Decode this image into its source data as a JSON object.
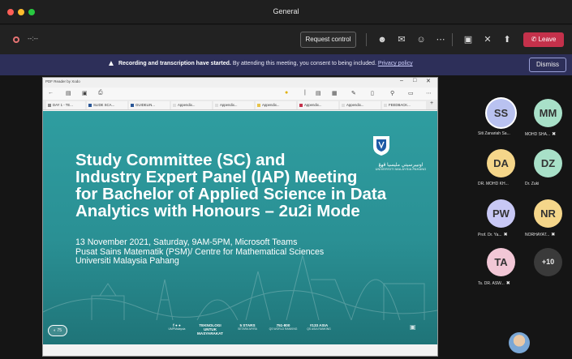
{
  "window": {
    "title": "General",
    "traffic_lights": [
      "#ff5f57",
      "#febc2e",
      "#28c840"
    ]
  },
  "toolbar": {
    "timer": "--:--",
    "request_control_label": "Request control",
    "icons": [
      "people-icon",
      "chat-icon",
      "reactions-icon",
      "more-icon",
      "camera-off-icon",
      "mic-off-icon",
      "share-icon"
    ],
    "leave_label": "Leave"
  },
  "banner": {
    "bold_text": "Recording and transcription have started.",
    "text": "By attending this meeting, you consent to being included.",
    "link": "Privacy policy",
    "dismiss_label": "Dismiss"
  },
  "pdf_viewer": {
    "title": "PDF Reader by Xodo",
    "tabs": [
      {
        "label": "DAY 1 - TE...",
        "color": "#888888"
      },
      {
        "label": "SLIDE SCA...",
        "color": "#2b5797"
      },
      {
        "label": "GUIDELIN...",
        "color": "#2b5797"
      },
      {
        "label": "Appendix...",
        "color": "#dddddd"
      },
      {
        "label": "Appendix...",
        "color": "#dddddd"
      },
      {
        "label": "Appendix...",
        "color": "#e6c34a"
      },
      {
        "label": "Appendix...",
        "color": "#c4314b"
      },
      {
        "label": "Appendix...",
        "color": "#dddddd"
      },
      {
        "label": "FEEDBACK...",
        "color": "#dddddd"
      }
    ]
  },
  "slide": {
    "title_lines": [
      "Study Committee (SC) and",
      "Industry Expert Panel (IAP) Meeting",
      "for Bachelor of Applied Science in Data",
      "Analytics with Honours – 2u2i Mode"
    ],
    "subtitle_lines": [
      "13 November 2021, Saturday, 9AM-5PM, Microsoft Teams",
      "Pusat Sains Matematik (PSM)/ Centre for Mathematical Sciences",
      "Universiti Malaysia Pahang"
    ],
    "logo_arabic": "اونيبرسيتي مليسيا ڤهڠ",
    "logo_english": "UNIVERSITI MALAYSIA PAHANG",
    "footer": [
      {
        "main": "UMPMalaysia",
        "sub": ""
      },
      {
        "main": "TEKNOLOGI UNTUK MASYARAKAT",
        "sub": ""
      },
      {
        "main": "5 STARS",
        "sub": "SETARA MYRA"
      },
      {
        "main": "751-800",
        "sub": "QS WORLD RANKING"
      },
      {
        "main": "#133 ASIA",
        "sub": "QS ASIA RANKING"
      }
    ],
    "footer_left": "◐ 75"
  },
  "participants": [
    {
      "initials": "SS",
      "name": "Siti Zanariah Sa...",
      "color": "#b9c2f0",
      "muted": false
    },
    {
      "initials": "MM",
      "name": "MOHD SHA...",
      "color": "#a8e0c8",
      "muted": true
    },
    {
      "initials": "DA",
      "name": "DR. MOHD KH...",
      "color": "#f5d68a",
      "muted": false
    },
    {
      "initials": "DZ",
      "name": "Dr. Zuki",
      "color": "#a8e0c8",
      "muted": false
    },
    {
      "initials": "PW",
      "name": "Prof. Dr. Ya...",
      "color": "#c8c8f5",
      "muted": true
    },
    {
      "initials": "NR",
      "name": "NORHAYAT...",
      "color": "#f5d68a",
      "muted": true
    },
    {
      "initials": "TA",
      "name": "Ts. DR. ASW...",
      "color": "#f2c7d6",
      "muted": true
    },
    {
      "initials": "+10",
      "name": "",
      "color": "#3a3a3a",
      "muted": false
    }
  ]
}
